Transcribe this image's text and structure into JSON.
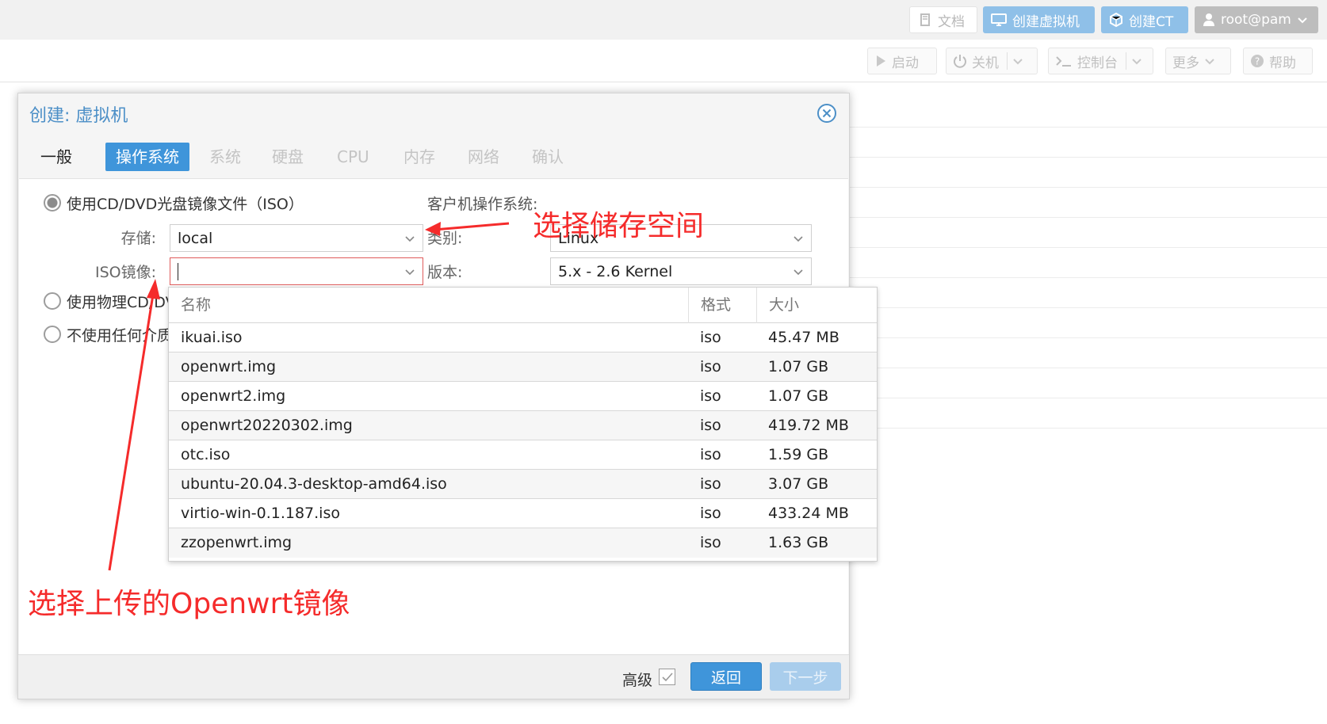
{
  "header": {
    "docs": "文档",
    "create_vm": "创建虚拟机",
    "create_ct": "创建CT",
    "user": "root@pam"
  },
  "toolbar": {
    "start": "启动",
    "shutdown": "关机",
    "console": "控制台",
    "more": "更多",
    "help": "帮助"
  },
  "dialog": {
    "title": "创建: 虚拟机",
    "tabs": [
      "一般",
      "操作系统",
      "系统",
      "硬盘",
      "CPU",
      "内存",
      "网络",
      "确认"
    ],
    "active_tab": "操作系统",
    "options": {
      "use_iso": "使用CD/DVD光盘镜像文件（ISO）",
      "use_physical": "使用物理CD/DV",
      "no_media": "不使用任何介质"
    },
    "storage_label": "存储:",
    "storage_value": "local",
    "iso_label": "ISO镜像:",
    "iso_value": "",
    "guest_os_label": "客户机操作系统:",
    "type_label": "类别:",
    "type_value": "Linux",
    "version_label": "版本:",
    "version_value": "5.x - 2.6 Kernel",
    "advanced_label": "高级",
    "back_button": "返回",
    "next_button": "下一步"
  },
  "iso_picker": {
    "columns": [
      "名称",
      "格式",
      "大小"
    ],
    "rows": [
      {
        "name": "ikuai.iso",
        "format": "iso",
        "size": "45.47 MB"
      },
      {
        "name": "openwrt.img",
        "format": "iso",
        "size": "1.07 GB"
      },
      {
        "name": "openwrt2.img",
        "format": "iso",
        "size": "1.07 GB"
      },
      {
        "name": "openwrt20220302.img",
        "format": "iso",
        "size": "419.72 MB"
      },
      {
        "name": "otc.iso",
        "format": "iso",
        "size": "1.59 GB"
      },
      {
        "name": "ubuntu-20.04.3-desktop-amd64.iso",
        "format": "iso",
        "size": "3.07 GB"
      },
      {
        "name": "virtio-win-0.1.187.iso",
        "format": "iso",
        "size": "433.24 MB"
      },
      {
        "name": "zzopenwrt.img",
        "format": "iso",
        "size": "1.63 GB"
      }
    ]
  },
  "annotations": {
    "storage_hint": "选择储存空间",
    "iso_hint": "选择上传的Openwrt镜像",
    "color": "#f52b2b"
  },
  "colors": {
    "accent": "#3f95da",
    "title": "#4c8fc7",
    "invalid": "#e05b5b"
  }
}
